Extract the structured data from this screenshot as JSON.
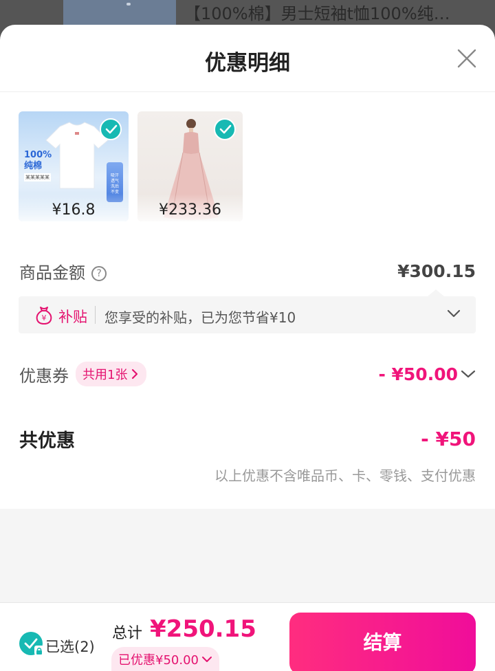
{
  "background": {
    "product_title": "【100%棉】男士短袖t恤100%纯…"
  },
  "sheet": {
    "title": "优惠明细",
    "close_icon": "close-icon"
  },
  "products": [
    {
      "price": "¥16.8",
      "selected": true,
      "image_text": "100%\n纯棉",
      "image_tag": "吸汗透气 洗后不变",
      "image_sub": "某某某某某"
    },
    {
      "price": "¥233.36",
      "selected": true
    }
  ],
  "goods_amount": {
    "label": "商品金额",
    "help_icon": "question-circle-icon",
    "value": "¥300.15"
  },
  "subsidy": {
    "icon": "money-bag-icon",
    "tag": "补贴",
    "text": "您享受的补贴，已为您节省¥10",
    "chevron_icon": "chevron-down-icon"
  },
  "coupon": {
    "label": "优惠券",
    "pill": "共用1张",
    "value": "- ¥50.00"
  },
  "total_discount": {
    "label": "共优惠",
    "value": "- ¥50",
    "note": "以上优惠不含唯品币、卡、零钱、支付优惠"
  },
  "bottom_bar": {
    "selected_label": "已选(2)",
    "total_label": "总计",
    "total_price": "¥250.15",
    "saved_label": "已优惠¥50.00",
    "checkout_label": "结算"
  },
  "colors": {
    "accent": "#f0147a",
    "check": "#17b9b3"
  }
}
